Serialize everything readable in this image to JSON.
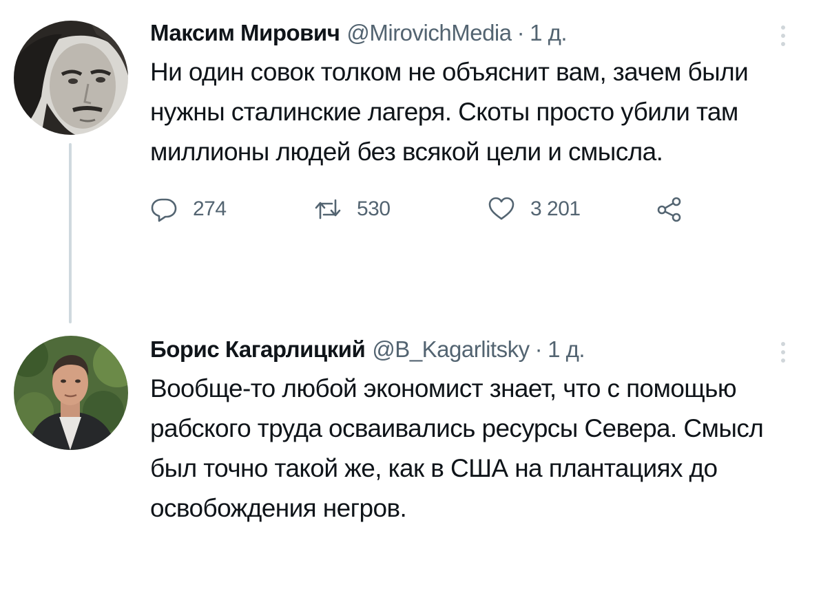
{
  "tweets": [
    {
      "author": {
        "display_name": "Максим Мирович",
        "handle": "@MirovichMedia",
        "avatar": "avatar-portrait-icon"
      },
      "separator": "·",
      "time": "1 д.",
      "text": "Ни один совок толком не объяснит вам, зачем были нужны сталинские лагеря. Скоты просто убили там миллионы людей без всякой цели и смысла.",
      "stats": {
        "replies": "274",
        "retweets": "530",
        "likes": "3 201"
      },
      "icons": {
        "reply": "reply-icon",
        "retweet": "retweet-icon",
        "like": "heart-icon",
        "share": "share-icon",
        "more": "more-icon"
      }
    },
    {
      "author": {
        "display_name": "Борис Кагарлицкий",
        "handle": "@B_Kagarlitsky",
        "avatar": "avatar-photo-icon"
      },
      "separator": "·",
      "time": "1 д.",
      "text": "Вообще-то любой экономист знает, что с помощью рабского труда осваивались ресурсы Севера. Смысл был точно такой же, как в США на плантациях до освобождения негров.",
      "icons": {
        "more": "more-icon"
      }
    }
  ],
  "colors": {
    "text_primary": "#0f1419",
    "text_secondary": "#536471",
    "thread_line": "#cfd9de",
    "background": "#ffffff"
  }
}
